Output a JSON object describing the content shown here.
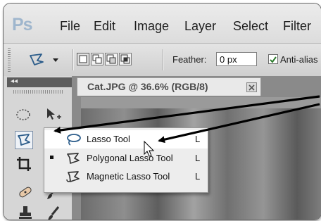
{
  "app": {
    "logo": "Ps"
  },
  "menu": [
    "File",
    "Edit",
    "Image",
    "Layer",
    "Select",
    "Filter"
  ],
  "options_bar": {
    "feather_label": "Feather:",
    "feather_value": "0 px",
    "antialias_label": "Anti-alias",
    "antialias_checked": true
  },
  "tools_panel": {
    "collapse_glyph": "◂◂"
  },
  "document": {
    "tab_title": "Cat.JPG @ 36.6% (RGB/8)"
  },
  "flyout": {
    "items": [
      {
        "label": "Lasso Tool",
        "shortcut": "L",
        "icon": "lasso-icon",
        "selected": false
      },
      {
        "label": "Polygonal Lasso Tool",
        "shortcut": "L",
        "icon": "polygonal-lasso-icon",
        "selected": true
      },
      {
        "label": "Magnetic Lasso Tool",
        "shortcut": "L",
        "icon": "magnetic-lasso-icon",
        "selected": false
      }
    ]
  },
  "colors": {
    "accent": "#1f6fbf",
    "logo": "#9fb6cd",
    "panel_head": "#5c5c5c"
  }
}
